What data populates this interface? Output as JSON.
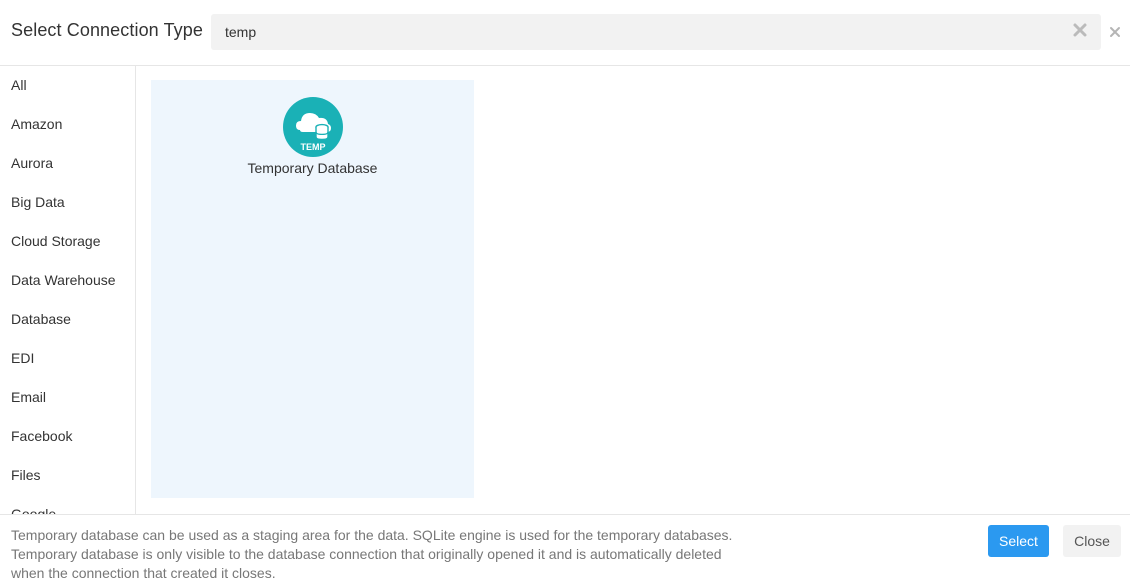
{
  "dialog": {
    "title": "Select Connection Type",
    "close_icon": "close-icon"
  },
  "search": {
    "value": "temp",
    "clear_icon": "clear-icon"
  },
  "sidebar": {
    "items": [
      {
        "label": "All"
      },
      {
        "label": "Amazon"
      },
      {
        "label": "Aurora"
      },
      {
        "label": "Big Data"
      },
      {
        "label": "Cloud Storage"
      },
      {
        "label": "Data Warehouse"
      },
      {
        "label": "Database"
      },
      {
        "label": "EDI"
      },
      {
        "label": "Email"
      },
      {
        "label": "Facebook"
      },
      {
        "label": "Files"
      },
      {
        "label": "Google"
      }
    ]
  },
  "results": [
    {
      "label": "Temporary Database",
      "icon": "temp-cloud-database-icon",
      "badge": "TEMP",
      "icon_color": "#1ab1b6"
    }
  ],
  "footer": {
    "description_lines": [
      "Temporary database can be used as a staging area for the data. SQLite engine is used for the temporary databases.",
      "Temporary database is only visible to the database connection that originally opened it and is automatically deleted",
      "when the connection that created it closes."
    ],
    "select_label": "Select",
    "close_label": "Close"
  },
  "colors": {
    "accent": "#2b99f0",
    "card_selected_bg": "#eef6fd",
    "icon_teal": "#1ab1b6"
  }
}
